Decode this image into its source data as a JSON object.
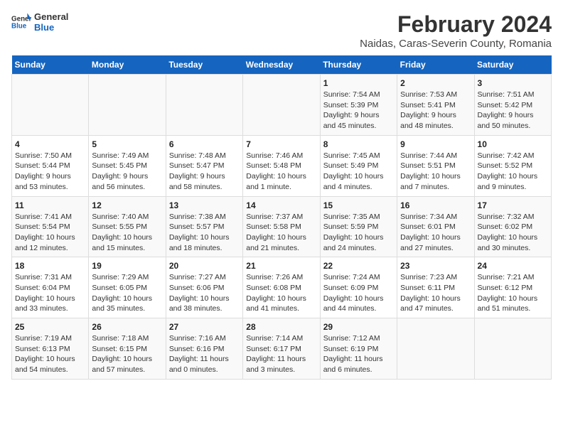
{
  "logo": {
    "line1": "General",
    "line2": "Blue"
  },
  "title": "February 2024",
  "subtitle": "Naidas, Caras-Severin County, Romania",
  "days_of_week": [
    "Sunday",
    "Monday",
    "Tuesday",
    "Wednesday",
    "Thursday",
    "Friday",
    "Saturday"
  ],
  "weeks": [
    [
      {
        "day": "",
        "info": ""
      },
      {
        "day": "",
        "info": ""
      },
      {
        "day": "",
        "info": ""
      },
      {
        "day": "",
        "info": ""
      },
      {
        "day": "1",
        "info": "Sunrise: 7:54 AM\nSunset: 5:39 PM\nDaylight: 9 hours\nand 45 minutes."
      },
      {
        "day": "2",
        "info": "Sunrise: 7:53 AM\nSunset: 5:41 PM\nDaylight: 9 hours\nand 48 minutes."
      },
      {
        "day": "3",
        "info": "Sunrise: 7:51 AM\nSunset: 5:42 PM\nDaylight: 9 hours\nand 50 minutes."
      }
    ],
    [
      {
        "day": "4",
        "info": "Sunrise: 7:50 AM\nSunset: 5:44 PM\nDaylight: 9 hours\nand 53 minutes."
      },
      {
        "day": "5",
        "info": "Sunrise: 7:49 AM\nSunset: 5:45 PM\nDaylight: 9 hours\nand 56 minutes."
      },
      {
        "day": "6",
        "info": "Sunrise: 7:48 AM\nSunset: 5:47 PM\nDaylight: 9 hours\nand 58 minutes."
      },
      {
        "day": "7",
        "info": "Sunrise: 7:46 AM\nSunset: 5:48 PM\nDaylight: 10 hours\nand 1 minute."
      },
      {
        "day": "8",
        "info": "Sunrise: 7:45 AM\nSunset: 5:49 PM\nDaylight: 10 hours\nand 4 minutes."
      },
      {
        "day": "9",
        "info": "Sunrise: 7:44 AM\nSunset: 5:51 PM\nDaylight: 10 hours\nand 7 minutes."
      },
      {
        "day": "10",
        "info": "Sunrise: 7:42 AM\nSunset: 5:52 PM\nDaylight: 10 hours\nand 9 minutes."
      }
    ],
    [
      {
        "day": "11",
        "info": "Sunrise: 7:41 AM\nSunset: 5:54 PM\nDaylight: 10 hours\nand 12 minutes."
      },
      {
        "day": "12",
        "info": "Sunrise: 7:40 AM\nSunset: 5:55 PM\nDaylight: 10 hours\nand 15 minutes."
      },
      {
        "day": "13",
        "info": "Sunrise: 7:38 AM\nSunset: 5:57 PM\nDaylight: 10 hours\nand 18 minutes."
      },
      {
        "day": "14",
        "info": "Sunrise: 7:37 AM\nSunset: 5:58 PM\nDaylight: 10 hours\nand 21 minutes."
      },
      {
        "day": "15",
        "info": "Sunrise: 7:35 AM\nSunset: 5:59 PM\nDaylight: 10 hours\nand 24 minutes."
      },
      {
        "day": "16",
        "info": "Sunrise: 7:34 AM\nSunset: 6:01 PM\nDaylight: 10 hours\nand 27 minutes."
      },
      {
        "day": "17",
        "info": "Sunrise: 7:32 AM\nSunset: 6:02 PM\nDaylight: 10 hours\nand 30 minutes."
      }
    ],
    [
      {
        "day": "18",
        "info": "Sunrise: 7:31 AM\nSunset: 6:04 PM\nDaylight: 10 hours\nand 33 minutes."
      },
      {
        "day": "19",
        "info": "Sunrise: 7:29 AM\nSunset: 6:05 PM\nDaylight: 10 hours\nand 35 minutes."
      },
      {
        "day": "20",
        "info": "Sunrise: 7:27 AM\nSunset: 6:06 PM\nDaylight: 10 hours\nand 38 minutes."
      },
      {
        "day": "21",
        "info": "Sunrise: 7:26 AM\nSunset: 6:08 PM\nDaylight: 10 hours\nand 41 minutes."
      },
      {
        "day": "22",
        "info": "Sunrise: 7:24 AM\nSunset: 6:09 PM\nDaylight: 10 hours\nand 44 minutes."
      },
      {
        "day": "23",
        "info": "Sunrise: 7:23 AM\nSunset: 6:11 PM\nDaylight: 10 hours\nand 47 minutes."
      },
      {
        "day": "24",
        "info": "Sunrise: 7:21 AM\nSunset: 6:12 PM\nDaylight: 10 hours\nand 51 minutes."
      }
    ],
    [
      {
        "day": "25",
        "info": "Sunrise: 7:19 AM\nSunset: 6:13 PM\nDaylight: 10 hours\nand 54 minutes."
      },
      {
        "day": "26",
        "info": "Sunrise: 7:18 AM\nSunset: 6:15 PM\nDaylight: 10 hours\nand 57 minutes."
      },
      {
        "day": "27",
        "info": "Sunrise: 7:16 AM\nSunset: 6:16 PM\nDaylight: 11 hours\nand 0 minutes."
      },
      {
        "day": "28",
        "info": "Sunrise: 7:14 AM\nSunset: 6:17 PM\nDaylight: 11 hours\nand 3 minutes."
      },
      {
        "day": "29",
        "info": "Sunrise: 7:12 AM\nSunset: 6:19 PM\nDaylight: 11 hours\nand 6 minutes."
      },
      {
        "day": "",
        "info": ""
      },
      {
        "day": "",
        "info": ""
      }
    ]
  ]
}
